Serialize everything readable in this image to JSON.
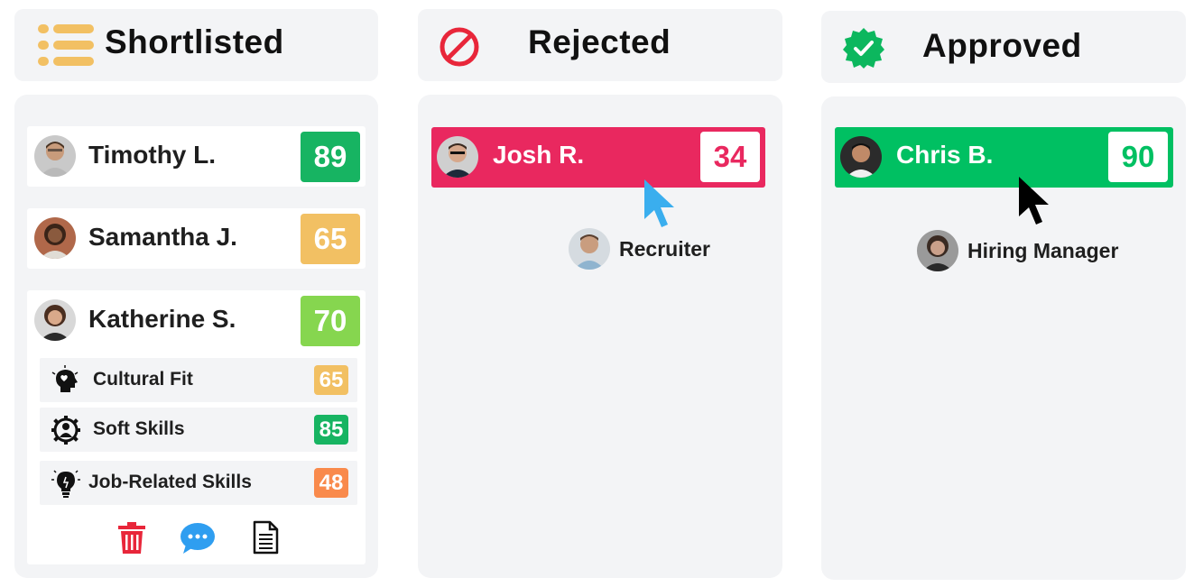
{
  "columns": {
    "shortlisted": {
      "title": "Shortlisted",
      "icon": "list-icon"
    },
    "rejected": {
      "title": "Rejected",
      "icon": "prohibited-icon"
    },
    "approved": {
      "title": "Approved",
      "icon": "verified-check-icon"
    }
  },
  "shortlisted_candidates": [
    {
      "name": "Timothy L.",
      "score": "89",
      "score_color": "#17b462"
    },
    {
      "name": "Samantha J.",
      "score": "65",
      "score_color": "#f2c063"
    },
    {
      "name": "Katherine S.",
      "score": "70",
      "score_color": "#86d64f"
    }
  ],
  "expanded_skills": [
    {
      "label": "Cultural Fit",
      "score": "65",
      "color": "#f2c063",
      "icon": "head-heart-icon"
    },
    {
      "label": "Soft Skills",
      "score": "85",
      "color": "#17b462",
      "icon": "people-gear-icon"
    },
    {
      "label": "Job-Related Skills",
      "score": "48",
      "color": "#f98a4c",
      "icon": "lightbulb-icon"
    }
  ],
  "card_actions": [
    "trash-icon",
    "chat-icon",
    "document-icon"
  ],
  "rejected_card": {
    "name": "Josh R.",
    "score": "34",
    "bg_color": "#e9285f"
  },
  "approved_card": {
    "name": "Chris B.",
    "score": "90",
    "bg_color": "#00c062"
  },
  "collaborators": {
    "recruiter": {
      "role": "Recruiter",
      "cursor_color": "#3aaeee"
    },
    "hiring_manager": {
      "role": "Hiring Manager",
      "cursor_color": "#000000"
    }
  }
}
